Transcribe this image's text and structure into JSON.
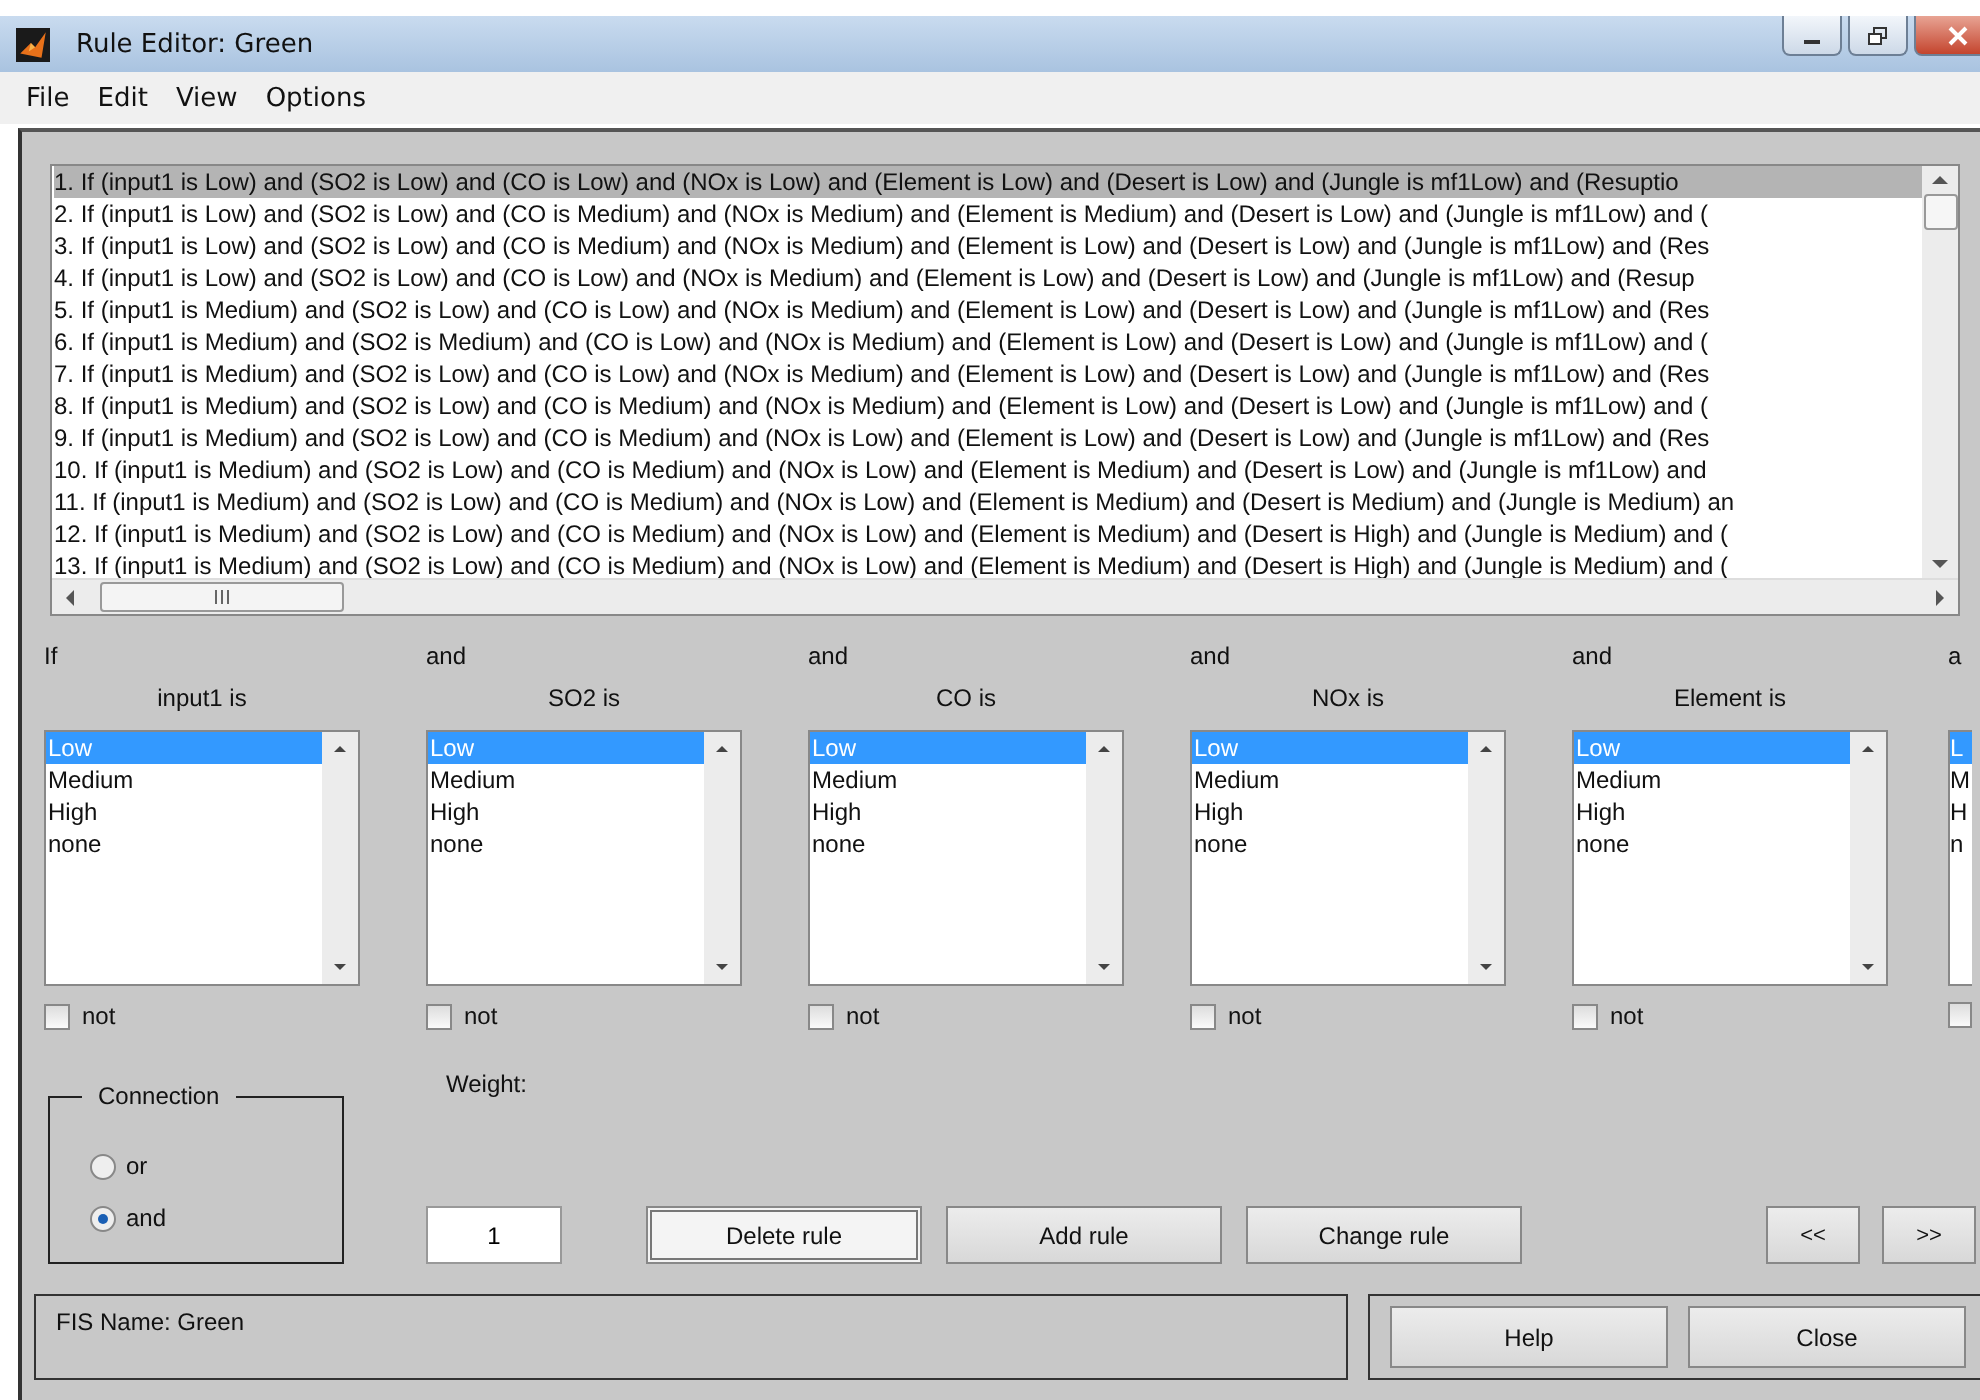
{
  "window": {
    "title": "Rule Editor: Green"
  },
  "menu": [
    "File",
    "Edit",
    "View",
    "Options"
  ],
  "rules": [
    {
      "text": "1. If (input1 is Low) and (SO2 is Low) and (CO is Low) and (NOx is Low) and (Element is Low) and (Desert is Low) and (Jungle is mf1Low) and (Resuptio",
      "selected": true
    },
    {
      "text": "2. If (input1 is Low) and (SO2 is Low) and (CO is Medium) and (NOx is Medium) and (Element is Medium) and (Desert is Low) and (Jungle is mf1Low) and (",
      "selected": false
    },
    {
      "text": "3. If (input1 is Low) and (SO2 is Low) and (CO is Medium) and (NOx is Medium) and (Element is Low) and (Desert is Low) and (Jungle is mf1Low) and (Res",
      "selected": false
    },
    {
      "text": "4. If (input1 is Low) and (SO2 is Low) and (CO is Low) and (NOx is Medium) and (Element is Low) and (Desert is Low) and (Jungle is mf1Low) and (Resup",
      "selected": false
    },
    {
      "text": "5. If (input1 is Medium) and (SO2 is Low) and (CO is Low) and (NOx is Medium) and (Element is Low) and (Desert is Low) and (Jungle is mf1Low) and (Res",
      "selected": false
    },
    {
      "text": "6. If (input1 is Medium) and (SO2 is Medium) and (CO is Low) and (NOx is Medium) and (Element is Low) and (Desert is Low) and (Jungle is mf1Low) and (",
      "selected": false
    },
    {
      "text": "7. If (input1 is Medium) and (SO2 is Low) and (CO is Low) and (NOx is Medium) and (Element is Low) and (Desert is Low) and (Jungle is mf1Low) and (Res",
      "selected": false
    },
    {
      "text": "8. If (input1 is Medium) and (SO2 is Low) and (CO is Medium) and (NOx is Medium) and (Element is Low) and (Desert is Low) and (Jungle is mf1Low) and (",
      "selected": false
    },
    {
      "text": "9. If (input1 is Medium) and (SO2 is Low) and (CO is Medium) and (NOx is Low) and (Element is Low) and (Desert is Low) and (Jungle is mf1Low) and (Res",
      "selected": false
    },
    {
      "text": "10. If (input1 is Medium) and (SO2 is Low) and (CO is Medium) and (NOx is Low) and (Element is Medium) and (Desert is Low) and (Jungle is mf1Low) and",
      "selected": false
    },
    {
      "text": "11. If (input1 is Medium) and (SO2 is Low) and (CO is Medium) and (NOx is Low) and (Element is Medium) and (Desert is Medium) and (Jungle is Medium) an",
      "selected": false
    },
    {
      "text": "12. If (input1 is Medium) and (SO2 is Low) and (CO is Medium) and (NOx is Low) and (Element is Medium) and (Desert is High) and (Jungle is Medium) and (",
      "selected": false
    },
    {
      "text": "13. If (input1 is Medium) and (SO2 is Low) and (CO is Medium) and (NOx is Low) and (Element is Medium) and (Desert is High) and (Jungle is Medium) and (",
      "selected": false
    }
  ],
  "antecedents": [
    {
      "connector": "If",
      "label": "input1 is",
      "not": false,
      "not_label": "not",
      "options": [
        {
          "text": "Low",
          "selected": true
        },
        {
          "text": "Medium",
          "selected": false
        },
        {
          "text": "High",
          "selected": false
        },
        {
          "text": "none",
          "selected": false
        }
      ]
    },
    {
      "connector": "and",
      "label": "SO2 is",
      "not": false,
      "not_label": "not",
      "options": [
        {
          "text": "Low",
          "selected": true
        },
        {
          "text": "Medium",
          "selected": false
        },
        {
          "text": "High",
          "selected": false
        },
        {
          "text": "none",
          "selected": false
        }
      ]
    },
    {
      "connector": "and",
      "label": "CO is",
      "not": false,
      "not_label": "not",
      "options": [
        {
          "text": "Low",
          "selected": true
        },
        {
          "text": "Medium",
          "selected": false
        },
        {
          "text": "High",
          "selected": false
        },
        {
          "text": "none",
          "selected": false
        }
      ]
    },
    {
      "connector": "and",
      "label": "NOx is",
      "not": false,
      "not_label": "not",
      "options": [
        {
          "text": "Low",
          "selected": true
        },
        {
          "text": "Medium",
          "selected": false
        },
        {
          "text": "High",
          "selected": false
        },
        {
          "text": "none",
          "selected": false
        }
      ]
    },
    {
      "connector": "and",
      "label": "Element is",
      "not": false,
      "not_label": "not",
      "options": [
        {
          "text": "Low",
          "selected": true
        },
        {
          "text": "Medium",
          "selected": false
        },
        {
          "text": "High",
          "selected": false
        },
        {
          "text": "none",
          "selected": false
        }
      ]
    },
    {
      "connector": "a",
      "not": false,
      "options": [
        {
          "text": "L",
          "selected": true
        },
        {
          "text": "M",
          "selected": false
        },
        {
          "text": "H",
          "selected": false
        },
        {
          "text": "n",
          "selected": false
        }
      ]
    }
  ],
  "connection": {
    "title": "Connection",
    "options": [
      {
        "label": "or",
        "selected": false
      },
      {
        "label": "and",
        "selected": true
      }
    ]
  },
  "weight": {
    "label": "Weight:",
    "value": "1"
  },
  "buttons": [
    "Delete rule",
    "Add rule",
    "Change rule"
  ],
  "nav_buttons": [
    "<<",
    ">>"
  ],
  "status": "FIS Name: Green",
  "footer_buttons": [
    "Help",
    "Close"
  ]
}
